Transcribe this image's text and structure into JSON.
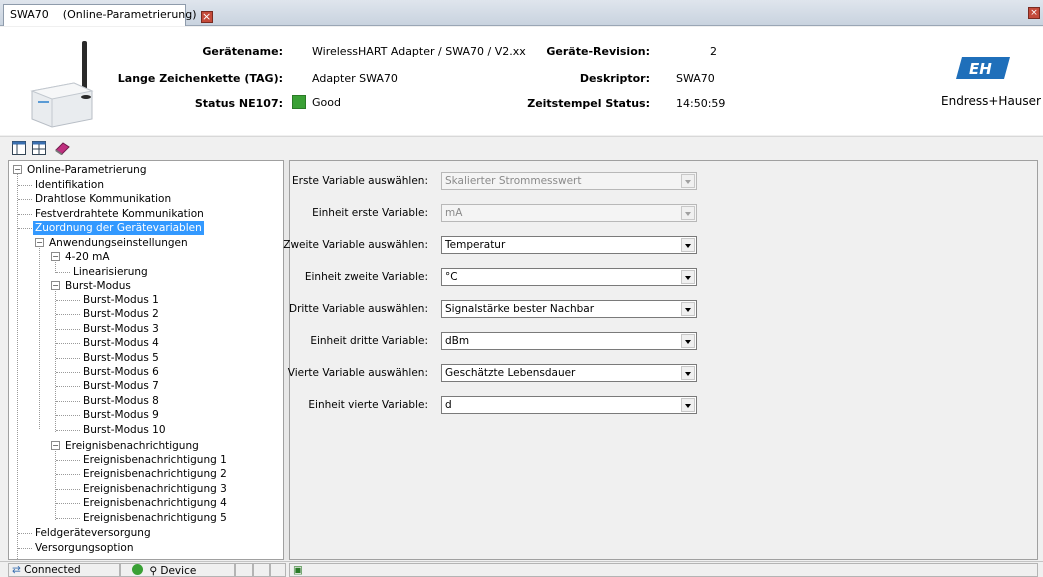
{
  "tab": {
    "name": "SWA70",
    "title": "(Online-Parametrierung)"
  },
  "header": {
    "geraetename_label": "Gerätename:",
    "geraetename_value": "WirelessHART Adapter / SWA70 / V2.xx",
    "tag_label": "Lange Zeichenkette (TAG):",
    "tag_value": "Adapter SWA70",
    "status_label": "Status NE107:",
    "status_value": "Good",
    "revision_label": "Geräte-Revision:",
    "revision_value": "2",
    "deskriptor_label": "Deskriptor:",
    "deskriptor_value": "SWA70",
    "zeitstempel_label": "Zeitstempel Status:",
    "zeitstempel_value": "14:50:59",
    "brand": "Endress+Hauser",
    "status_color": "#3aa035",
    "brand_color": "#1f6fba"
  },
  "tree": {
    "root": "Online-Parametrierung",
    "identifikation": "Identifikation",
    "drahtlose": "Drahtlose Kommunikation",
    "festverdrahtete": "Festverdrahtete Kommunikation",
    "zuordnung": "Zuordnung der Gerätevariablen",
    "anwendung": "Anwendungseinstellungen",
    "ma": "4-20 mA",
    "linearisierung": "Linearisierung",
    "burst": "Burst-Modus",
    "burst_items": [
      "Burst-Modus 1",
      "Burst-Modus 2",
      "Burst-Modus 3",
      "Burst-Modus 4",
      "Burst-Modus 5",
      "Burst-Modus 6",
      "Burst-Modus 7",
      "Burst-Modus 8",
      "Burst-Modus 9",
      "Burst-Modus 10"
    ],
    "ereignis": "Ereignisbenachrichtigung",
    "ereignis_items": [
      "Ereignisbenachrichtigung 1",
      "Ereignisbenachrichtigung 2",
      "Ereignisbenachrichtigung 3",
      "Ereignisbenachrichtigung 4",
      "Ereignisbenachrichtigung 5"
    ],
    "feld": "Feldgeräteversorgung",
    "versorgung": "Versorgungsoption"
  },
  "form": {
    "erste_label": "Erste Variable auswählen:",
    "erste_value": "Skalierter Strommesswert",
    "einheit_erste_label": "Einheit erste Variable:",
    "einheit_erste_value": "mA",
    "zweite_label": "Zweite Variable auswählen:",
    "zweite_value": "Temperatur",
    "einheit_zweite_label": "Einheit zweite Variable:",
    "einheit_zweite_value": "°C",
    "dritte_label": "Dritte Variable auswählen:",
    "dritte_value": "Signalstärke bester Nachbar",
    "einheit_dritte_label": "Einheit dritte Variable:",
    "einheit_dritte_value": "dBm",
    "vierte_label": "Vierte Variable auswählen:",
    "vierte_value": "Geschätzte Lebensdauer",
    "einheit_vierte_label": "Einheit vierte Variable:",
    "einheit_vierte_value": "d"
  },
  "statusbar": {
    "connected": "Connected",
    "device": "Device"
  },
  "icons": [
    "close-icon",
    "device-image",
    "brand-logo-icon",
    "layout-icon",
    "table-icon",
    "book-icon",
    "expand-icon",
    "collapse-icon",
    "dropdown-arrow-icon",
    "connection-icon",
    "device-status-icon",
    "device-icon",
    "panel-icon"
  ]
}
